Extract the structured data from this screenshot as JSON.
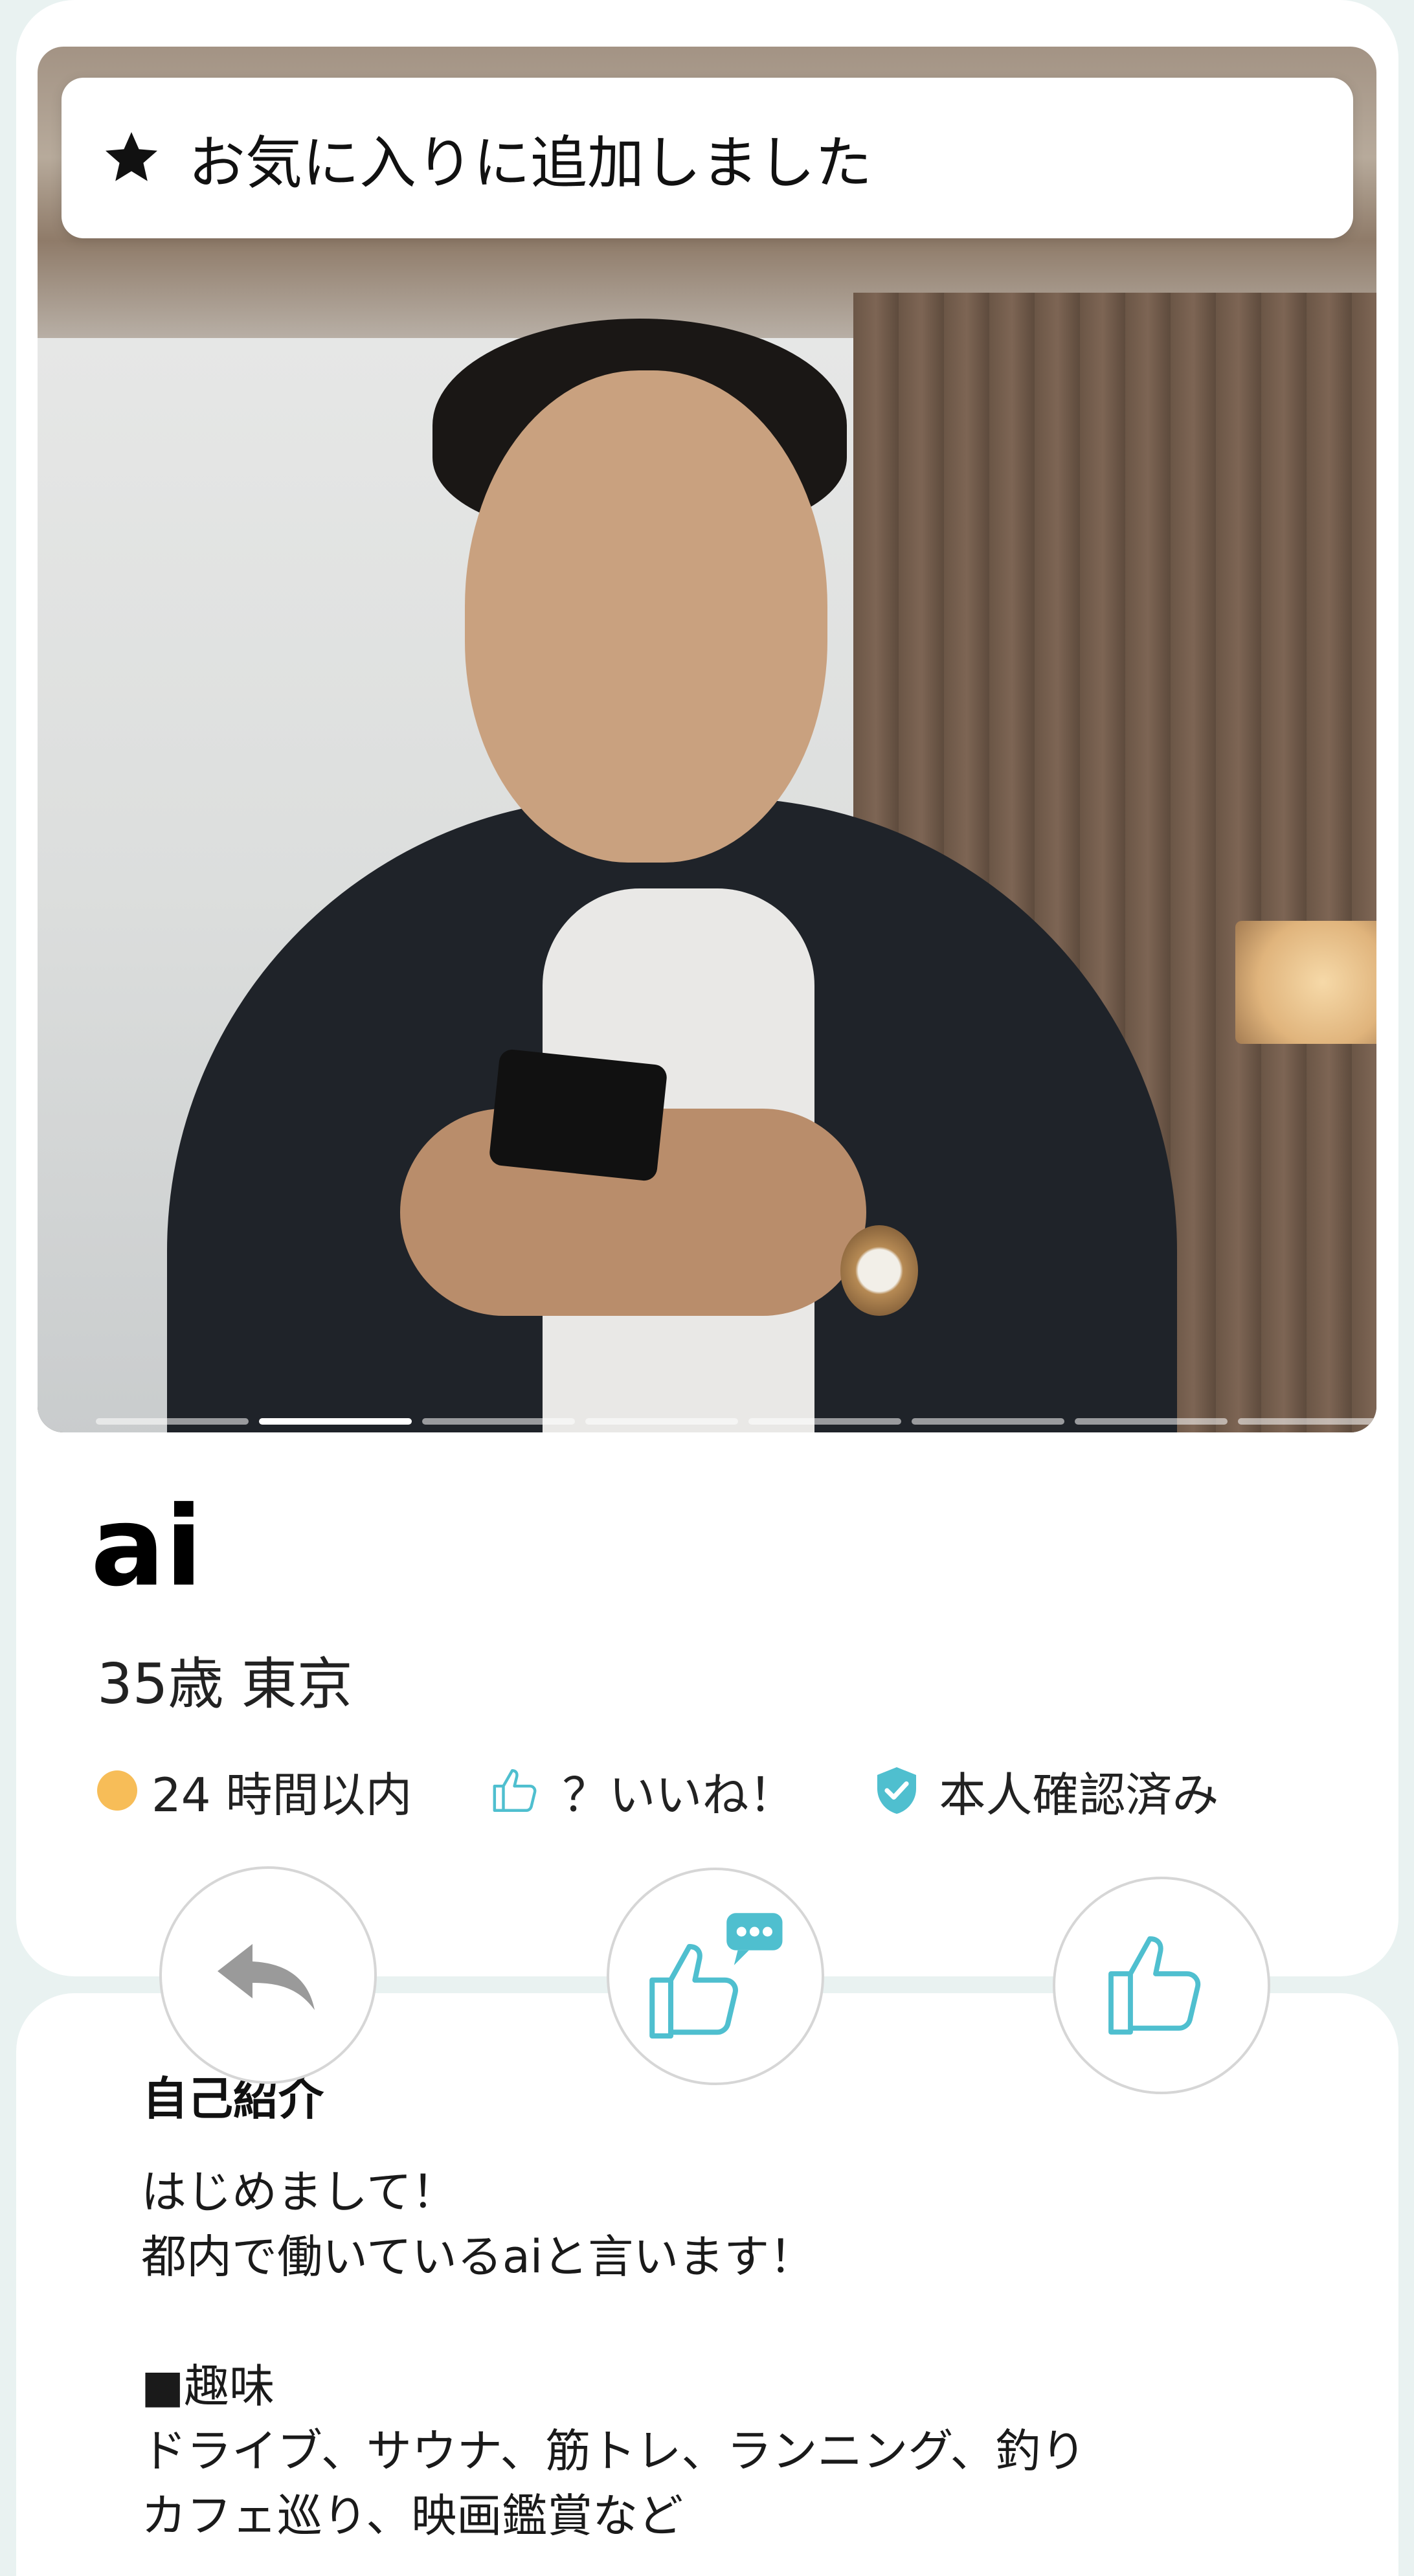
{
  "toast": {
    "message": "お気に入りに追加しました",
    "icon": "star-icon"
  },
  "photo": {
    "total_photos": 8,
    "active_index": 1
  },
  "profile": {
    "name": "ai",
    "age_location": "35歳 東京",
    "status": {
      "login": "24 時間以内",
      "login_color": "#f7bd58",
      "likes": "？いいね！",
      "verified": "本人確認済み"
    }
  },
  "actions": [
    {
      "name": "back",
      "icon": "undo-arrow-icon"
    },
    {
      "name": "like-with-message",
      "icon": "thumbs-up-message-icon"
    },
    {
      "name": "like",
      "icon": "thumbs-up-icon"
    }
  ],
  "intro": {
    "title": "自己紹介",
    "body": "はじめまして！\n都内で働いているaiと言います！\n\n■趣味\nドライブ、サウナ、筋トレ、ランニング、釣り\nカフェ巡り、映画鑑賞など"
  },
  "colors": {
    "accent": "#4fbfcf",
    "background": "#e9f2f1"
  }
}
